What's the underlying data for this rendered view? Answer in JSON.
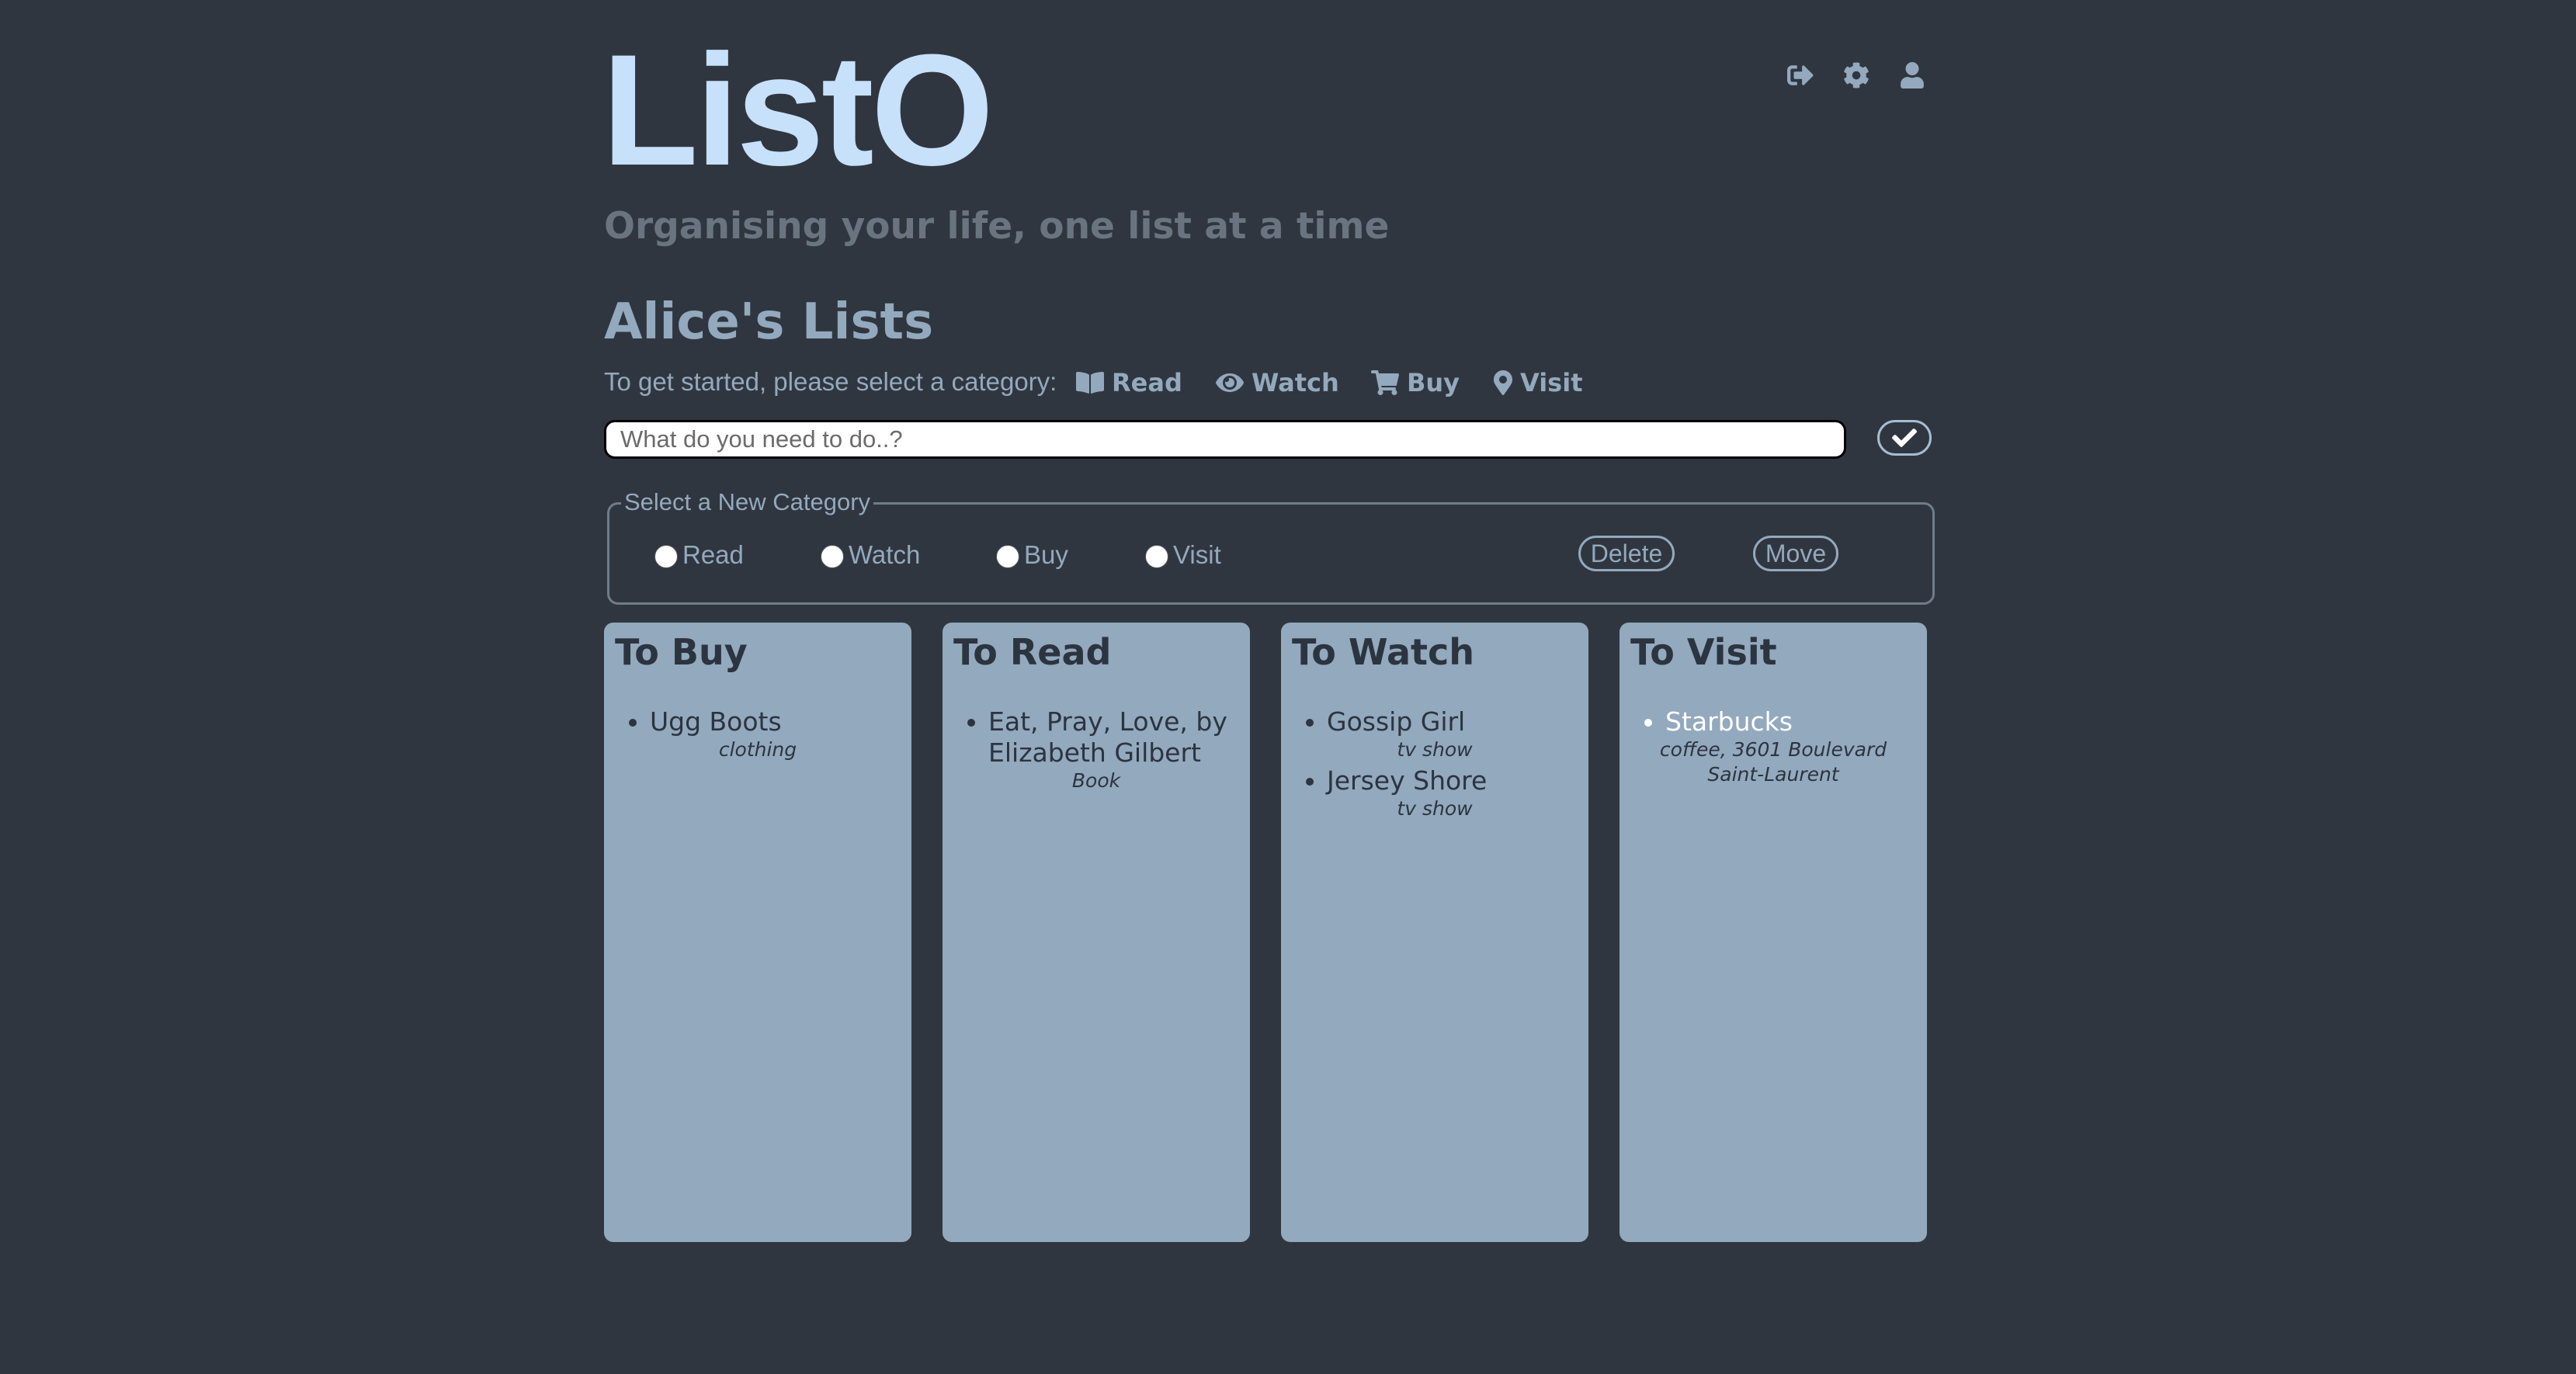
{
  "header": {
    "logo": "ListO",
    "tagline": "Organising your life, one list at a time",
    "icons": [
      "sign-out-icon",
      "gear-icon",
      "user-icon"
    ]
  },
  "page_title": "Alice's Lists",
  "intro_text": "To get started, please select a category:",
  "categories": [
    {
      "label": "Read",
      "icon": "book-icon"
    },
    {
      "label": "Watch",
      "icon": "eye-icon"
    },
    {
      "label": "Buy",
      "icon": "cart-icon"
    },
    {
      "label": "Visit",
      "icon": "map-marker-icon"
    }
  ],
  "new_item": {
    "placeholder": "What do you need to do..?",
    "value": ""
  },
  "recategorize": {
    "legend": "Select a New Category",
    "options": [
      "Read",
      "Watch",
      "Buy",
      "Visit"
    ],
    "delete_label": "Delete",
    "move_label": "Move"
  },
  "lists": [
    {
      "title": "To Buy",
      "items": [
        {
          "name": "Ugg Boots",
          "desc": "clothing",
          "selected": false
        }
      ]
    },
    {
      "title": "To Read",
      "items": [
        {
          "name": "Eat, Pray, Love, by Elizabeth Gilbert",
          "desc": "Book",
          "selected": false
        }
      ]
    },
    {
      "title": "To Watch",
      "items": [
        {
          "name": "Gossip Girl",
          "desc": "tv show",
          "selected": false
        },
        {
          "name": "Jersey Shore",
          "desc": "tv show",
          "selected": false
        }
      ]
    },
    {
      "title": "To Visit",
      "items": [
        {
          "name": "Starbucks",
          "desc": "coffee, 3601 Boulevard Saint-Laurent",
          "selected": true
        }
      ]
    }
  ],
  "colors": {
    "background": "#30363f",
    "logo": "#c7e1fb",
    "accent": "#93a9bd",
    "card": "#93a9bd",
    "card_text": "#2c3440",
    "selected_item": "#ffffff"
  }
}
